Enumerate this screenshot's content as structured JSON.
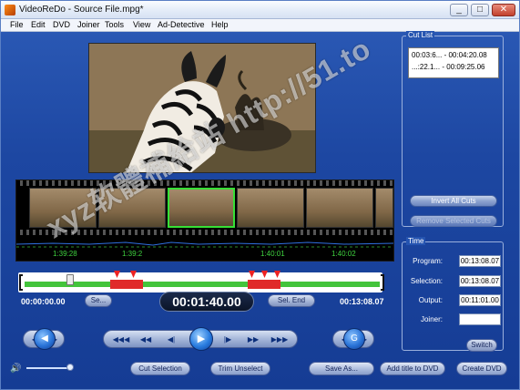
{
  "window": {
    "title": "VideoReDo - Source File.mpg*",
    "min": "_",
    "max": "□",
    "close": "✕"
  },
  "menu": [
    "File",
    "Edit",
    "DVD",
    "Joiner",
    "Tools",
    "View",
    "Ad-Detective",
    "Help"
  ],
  "filmstrip": {
    "timestamps": [
      "1:39:28",
      "1:39:2",
      "1:40:01",
      "1:40:02"
    ]
  },
  "cut_list": {
    "caption": "Cut List",
    "rows": [
      "00:03:6... - 00:04:20.08",
      "...:22.1... - 00:09:25.06"
    ],
    "invert_label": "Invert All Cuts",
    "remove_label": "Remove Selected Cuts"
  },
  "time_panel": {
    "caption": "Time",
    "program_label": "Program:",
    "program_value": "00:13:08.07",
    "selection_label": "Selection:",
    "selection_value": "00:13:08.07",
    "output_label": "Output:",
    "output_value": "00:11:01.00",
    "joiner_label": "Joiner:",
    "joiner_value": "",
    "switch_label": "Switch"
  },
  "timeline": {
    "start_time": "00:00:00.00",
    "current_time": "00:01:40.00",
    "end_time": "00:13:08.07",
    "sel_start_label": "Se...",
    "sel_end_label": "Sel. End",
    "position_fraction": 0.127
  },
  "transport": {
    "play": "▶",
    "rewind": "◀◀◀",
    "back": "◀◀",
    "step_back": "◀|",
    "step_fwd": "|▶",
    "fwd": "▶▶",
    "ffwd": "▶▶▶",
    "left_btn": "◀",
    "right_btn": "▶",
    "left_round": "◀",
    "g_round": "G"
  },
  "volume": {
    "icon": "🔊",
    "level": 0.9
  },
  "bottom_buttons": {
    "cut_selection": "Cut Selection",
    "trim_unselect": "Trim Unselect",
    "save_as": "Save As...",
    "add_title": "Add title to DVD",
    "create_dvd": "Create DVD"
  },
  "watermark": "xyz软體補給站 http://51.to"
}
